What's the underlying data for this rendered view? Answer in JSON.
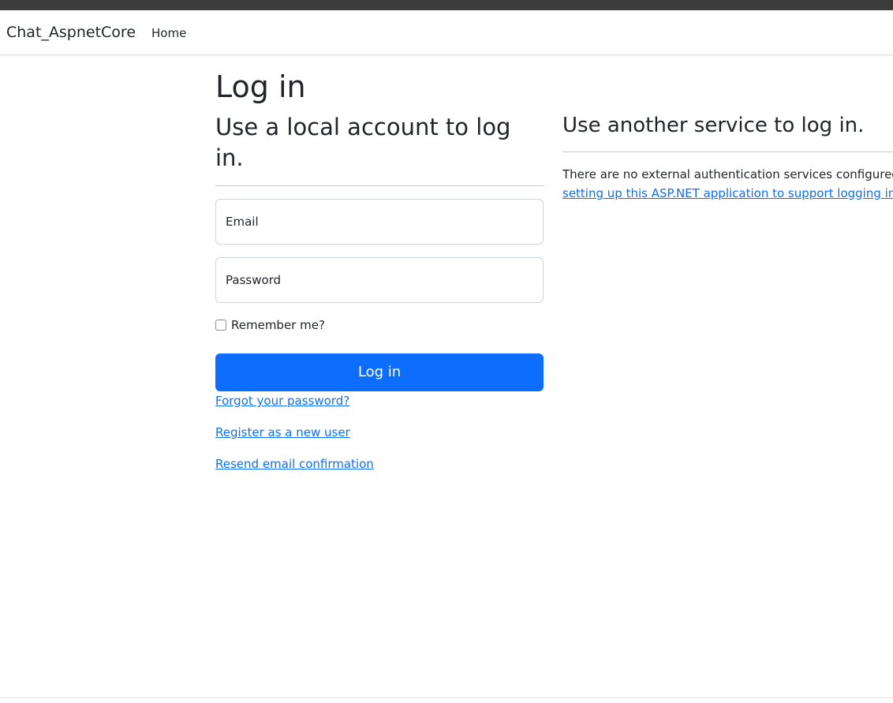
{
  "navbar": {
    "brand": "Chat_AspnetCore",
    "home_link": "Home"
  },
  "page": {
    "title": "Log in"
  },
  "local_login": {
    "heading": "Use a local account to log in.",
    "email_placeholder": "Email",
    "password_placeholder": "Password",
    "remember_label": "Remember me?",
    "submit_label": "Log in",
    "forgot_link": "Forgot your password?",
    "register_link": "Register as a new user",
    "resend_link": "Resend email confirmation"
  },
  "external_login": {
    "heading": "Use another service to log in.",
    "message": "There are no external authentication services configured. See this ",
    "link_text": "article about setting up this ASP.NET application to support logging in via external services"
  },
  "colors": {
    "primary": "#0d6efd",
    "text": "#212529",
    "top_strip": "#3c3c3c"
  }
}
